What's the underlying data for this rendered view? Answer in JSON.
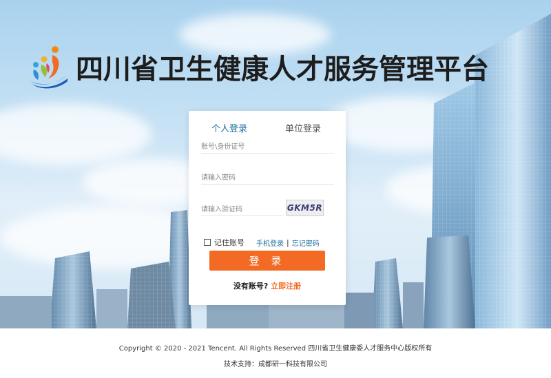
{
  "header": {
    "title": "四川省卫生健康人才服务管理平台"
  },
  "login": {
    "tabs": [
      "个人登录",
      "单位登录"
    ],
    "account_placeholder": "账号\\身份证号",
    "password_placeholder": "请输入密码",
    "captcha_placeholder": "请输入验证码",
    "captcha_text": "GKM5R",
    "remember_label": "记住账号",
    "phone_login_link": "手机登录",
    "separator": "|",
    "forgot_password_link": "忘记密码",
    "submit_label": "登 录",
    "no_account_text": "没有账号?",
    "register_link": "立即注册"
  },
  "footer": {
    "copyright": "Copyright © 2020 - 2021 Tencent. All Rights Reserved 四川省卫生健康委人才服务中心版权所有",
    "tech_support": "技术支持：成都研一科技有限公司"
  },
  "colors": {
    "accent": "#f26a24",
    "link": "#1f6f9f",
    "sky": "#c7e2f5"
  },
  "icons": {
    "logo": "people-logo-icon"
  }
}
